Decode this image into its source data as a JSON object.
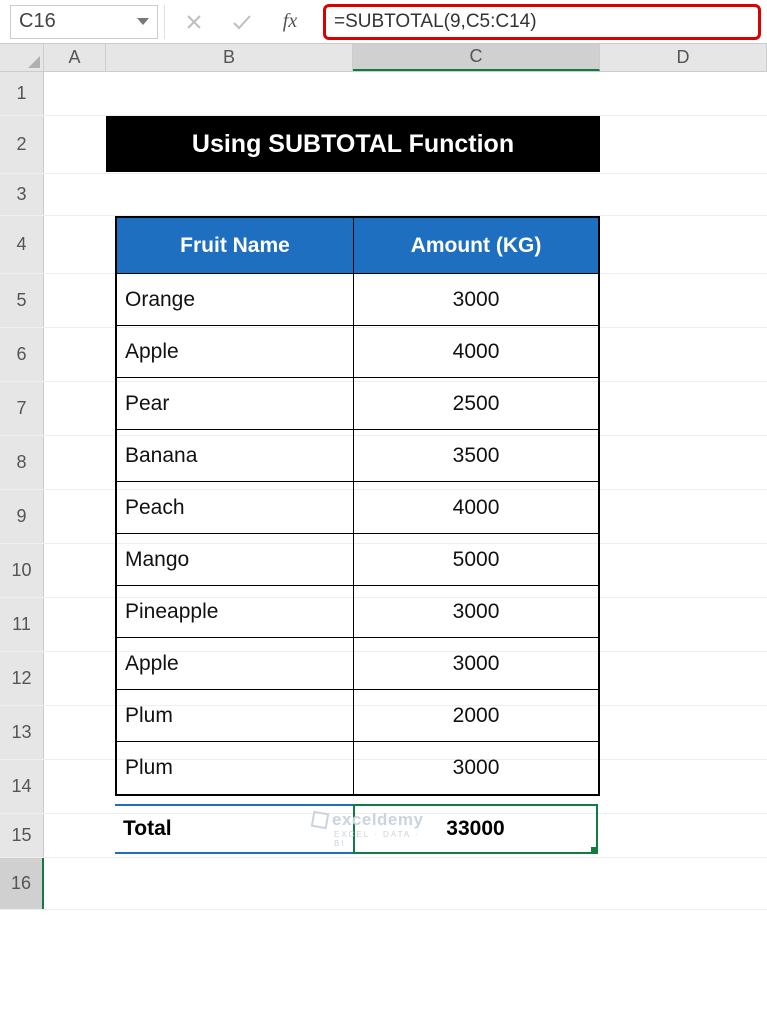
{
  "name_box": "C16",
  "formula": "=SUBTOTAL(9,C5:C14)",
  "fx_label": "fx",
  "columns": [
    "A",
    "B",
    "C",
    "D"
  ],
  "selected_column": "C",
  "selected_row": "16",
  "rows_display": [
    "1",
    "2",
    "3",
    "4",
    "5",
    "6",
    "7",
    "8",
    "9",
    "10",
    "11",
    "12",
    "13",
    "14",
    "15",
    "16"
  ],
  "title": "Using SUBTOTAL Function",
  "table": {
    "headers": {
      "name": "Fruit Name",
      "amount": "Amount (KG)"
    },
    "rows": [
      {
        "name": "Orange",
        "amount": "3000"
      },
      {
        "name": "Apple",
        "amount": "4000"
      },
      {
        "name": "Pear",
        "amount": "2500"
      },
      {
        "name": "Banana",
        "amount": "3500"
      },
      {
        "name": "Peach",
        "amount": "4000"
      },
      {
        "name": "Mango",
        "amount": "5000"
      },
      {
        "name": "Pineapple",
        "amount": "3000"
      },
      {
        "name": "Apple",
        "amount": "3000"
      },
      {
        "name": "Plum",
        "amount": "2000"
      },
      {
        "name": "Plum",
        "amount": "3000"
      }
    ]
  },
  "total": {
    "label": "Total",
    "value": "33000"
  },
  "watermark": {
    "brand": "exceldemy",
    "tag": "EXCEL · DATA · BI"
  },
  "chart_data": {
    "type": "table",
    "title": "Using SUBTOTAL Function",
    "columns": [
      "Fruit Name",
      "Amount (KG)"
    ],
    "rows": [
      [
        "Orange",
        3000
      ],
      [
        "Apple",
        4000
      ],
      [
        "Pear",
        2500
      ],
      [
        "Banana",
        3500
      ],
      [
        "Peach",
        4000
      ],
      [
        "Mango",
        5000
      ],
      [
        "Pineapple",
        3000
      ],
      [
        "Apple",
        3000
      ],
      [
        "Plum",
        2000
      ],
      [
        "Plum",
        3000
      ]
    ],
    "aggregate": {
      "label": "Total",
      "value": 33000,
      "formula": "=SUBTOTAL(9,C5:C14)"
    }
  }
}
